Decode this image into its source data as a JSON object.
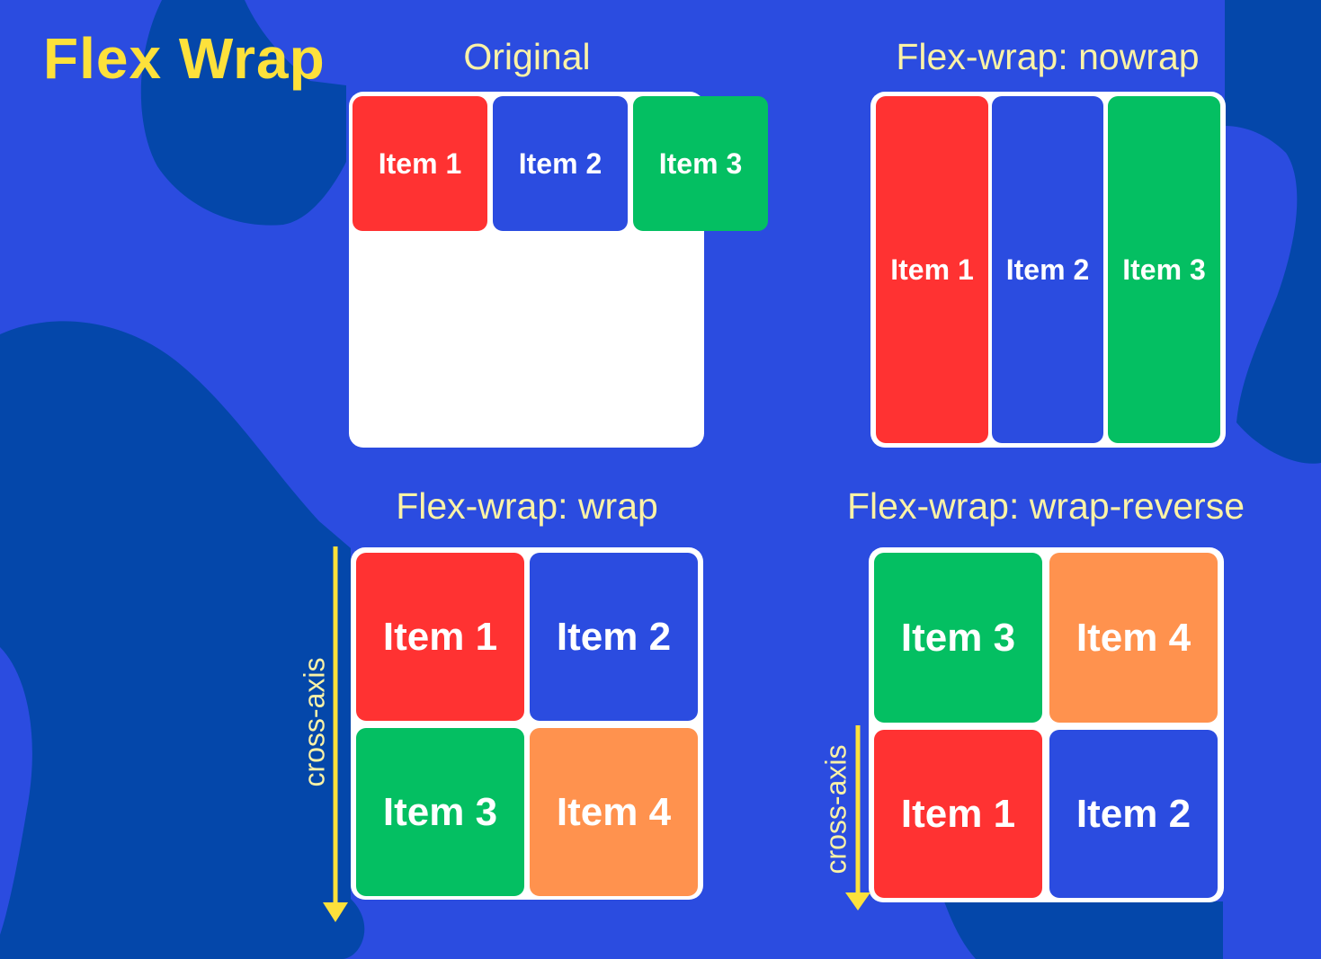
{
  "title": "Flex Wrap",
  "colors": {
    "background": "#2b4ce0",
    "blob": "#0447aa",
    "title": "#fde13b",
    "label": "#fbf2a6",
    "item_red": "#ff3232",
    "item_blue": "#2b4ce0",
    "item_green": "#04bf62",
    "item_orange": "#ff924e",
    "arrow": "#fde13b"
  },
  "sections": {
    "original": {
      "label": "Original",
      "items": [
        "Item 1",
        "Item 2",
        "Item 3"
      ]
    },
    "nowrap": {
      "label": "Flex-wrap: nowrap",
      "items": [
        "Item 1",
        "Item 2",
        "Item 3"
      ]
    },
    "wrap": {
      "label": "Flex-wrap: wrap",
      "items": [
        "Item 1",
        "Item 2",
        "Item 3",
        "Item 4"
      ],
      "axis_label": "cross-axis"
    },
    "wrap_reverse": {
      "label": "Flex-wrap: wrap-reverse",
      "items": [
        "Item 3",
        "Item 4",
        "Item 1",
        "Item 2"
      ],
      "axis_label": "cross-axis"
    }
  }
}
